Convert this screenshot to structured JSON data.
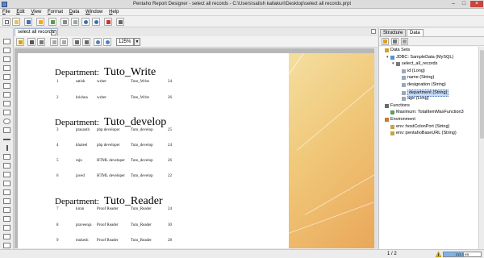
{
  "window": {
    "title": "Pentaho Report Designer - select all records - C:\\Users\\satish kallakuri\\Desktop\\select all records.prpt"
  },
  "menu": [
    "File",
    "Edit",
    "View",
    "Format",
    "Data",
    "Window",
    "Help"
  ],
  "editor": {
    "tab_label": "select all records",
    "zoom": "125%"
  },
  "report": {
    "department_label": "Department:",
    "groups": [
      {
        "department": "Tuto_Write",
        "rows": [
          {
            "id": "1",
            "name": "satish",
            "designation": "writer",
            "dept": "Tuto_Write",
            "age": "24"
          },
          {
            "id": "2",
            "name": "krishna",
            "designation": "writer",
            "dept": "Tuto_Write",
            "age": "26"
          }
        ]
      },
      {
        "department": "Tuto_develop",
        "rows": [
          {
            "id": "3",
            "name": "prasanth",
            "designation": "php developer",
            "dept": "Tuto_develop",
            "age": "25"
          },
          {
            "id": "4",
            "name": "khaleel",
            "designation": "php developer",
            "dept": "Tuto_develop",
            "age": "24"
          },
          {
            "id": "5",
            "name": "raju",
            "designation": "HTML developer",
            "dept": "Tuto_develop",
            "age": "26"
          },
          {
            "id": "6",
            "name": "javed",
            "designation": "HTML developer",
            "dept": "Tuto_develop",
            "age": "22"
          }
        ]
      },
      {
        "department": "Tuto_Reader",
        "rows": [
          {
            "id": "7",
            "name": "kiran",
            "designation": "Proof Reader",
            "dept": "Tuto_Reader",
            "age": "24"
          },
          {
            "id": "8",
            "name": "praveenja",
            "designation": "Proof Reader",
            "dept": "Tuto_Reader",
            "age": "30"
          },
          {
            "id": "9",
            "name": "mukesh",
            "designation": "Proof Reader",
            "dept": "Tuto_Reader",
            "age": "28"
          }
        ]
      }
    ]
  },
  "status": {
    "page_count": "1 / 2",
    "memory": "213.3 KB",
    "memory_used_fraction": 0.55
  },
  "right_panel": {
    "tabs": [
      "Structure",
      "Data"
    ],
    "active_tab": "Data",
    "tree": [
      {
        "label": "Data Sets",
        "level": 0,
        "toggle": "",
        "icon": "datasets-icon"
      },
      {
        "label": "JDBC: SampleData (MySQL)",
        "level": 1,
        "toggle": "▾",
        "icon": "database-icon"
      },
      {
        "label": "select_all_records",
        "level": 2,
        "toggle": "▾",
        "icon": "query-icon"
      },
      {
        "label": "id (Long)",
        "level": 3,
        "toggle": "",
        "icon": "field-icon"
      },
      {
        "label": "name (String)",
        "level": 3,
        "toggle": "",
        "icon": "field-icon"
      },
      {
        "label": "designation (String)",
        "level": 3,
        "toggle": "",
        "icon": "field-icon"
      },
      {
        "label": "department (String)",
        "level": 3,
        "toggle": "",
        "icon": "field-icon",
        "selected": true
      },
      {
        "label": "age (Long)",
        "level": 3,
        "toggle": "",
        "icon": "field-icon"
      },
      {
        "label": "Functions",
        "level": 0,
        "toggle": "",
        "icon": "functions-icon"
      },
      {
        "label": "Maximum: TotalItemMaxFunction3",
        "level": 1,
        "toggle": "",
        "icon": "function-icon"
      },
      {
        "label": "Environment",
        "level": 0,
        "toggle": "",
        "icon": "environment-icon"
      },
      {
        "label": "env::hostColonPort (String)",
        "level": 1,
        "toggle": "",
        "icon": "env-field-icon"
      },
      {
        "label": "env::pentahoBaseURL (String)",
        "level": 1,
        "toggle": "",
        "icon": "env-field-icon"
      }
    ]
  },
  "colors": {
    "accent": "#4a7ab8",
    "close": "#c9463d",
    "wallpaper": "#f0c778"
  }
}
